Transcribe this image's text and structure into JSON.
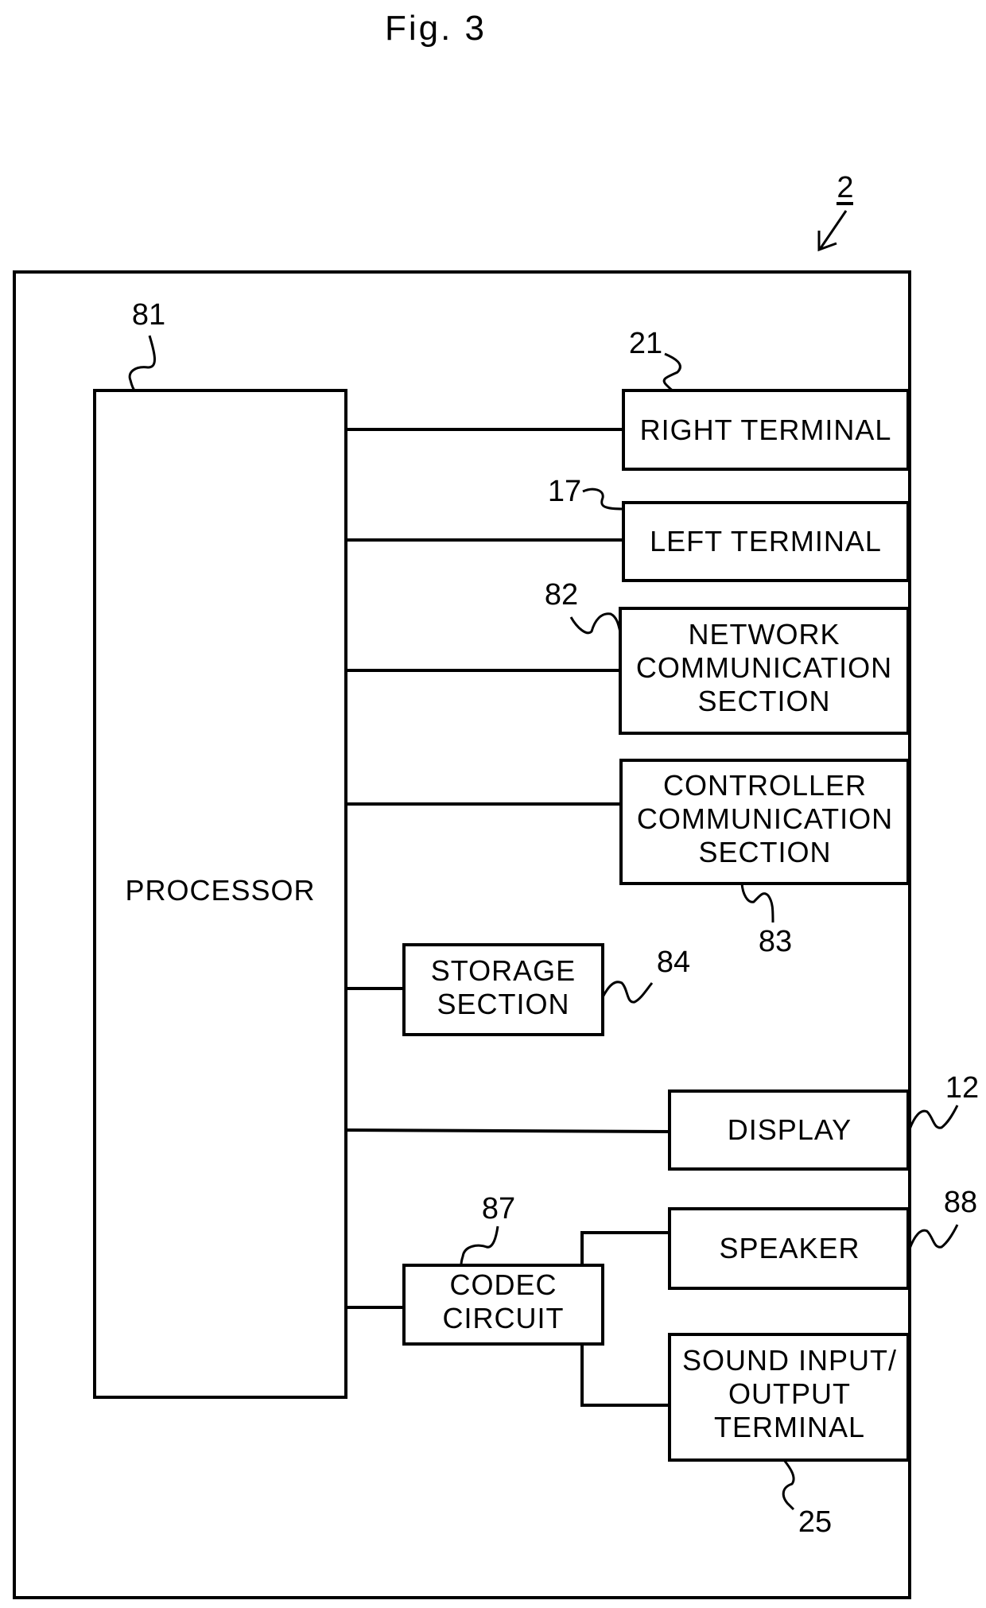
{
  "figure": {
    "title": "Fig. 3",
    "device_ref": "2"
  },
  "blocks": {
    "processor": {
      "ref": "81",
      "lines": [
        "PROCESSOR"
      ]
    },
    "right_terminal": {
      "ref": "21",
      "lines": [
        "RIGHT TERMINAL"
      ]
    },
    "left_terminal": {
      "ref": "17",
      "lines": [
        "LEFT TERMINAL"
      ]
    },
    "network_comm": {
      "ref": "82",
      "lines": [
        "NETWORK",
        "COMMUNICATION",
        "SECTION"
      ]
    },
    "controller_comm": {
      "ref": "83",
      "lines": [
        "CONTROLLER",
        "COMMUNICATION",
        "SECTION"
      ]
    },
    "storage": {
      "ref": "84",
      "lines": [
        "STORAGE",
        "SECTION"
      ]
    },
    "display": {
      "ref": "12",
      "lines": [
        "DISPLAY"
      ]
    },
    "codec": {
      "ref": "87",
      "lines": [
        "CODEC",
        "CIRCUIT"
      ]
    },
    "speaker": {
      "ref": "88",
      "lines": [
        "SPEAKER"
      ]
    },
    "sound_io": {
      "ref": "25",
      "lines": [
        "SOUND INPUT/",
        "OUTPUT",
        "TERMINAL"
      ]
    }
  },
  "connections": [
    [
      "processor",
      "right_terminal"
    ],
    [
      "processor",
      "left_terminal"
    ],
    [
      "processor",
      "network_comm"
    ],
    [
      "processor",
      "controller_comm"
    ],
    [
      "processor",
      "storage"
    ],
    [
      "processor",
      "display"
    ],
    [
      "processor",
      "codec"
    ],
    [
      "codec",
      "speaker"
    ],
    [
      "codec",
      "sound_io"
    ]
  ]
}
